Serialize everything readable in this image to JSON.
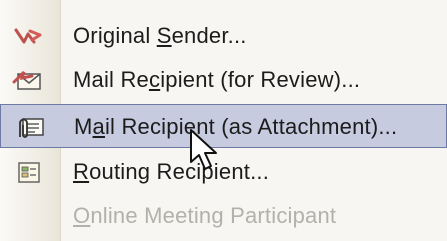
{
  "menu": {
    "items": [
      {
        "id": "original-sender",
        "label_pre": "Original ",
        "label_ul": "S",
        "label_post": "ender...",
        "icon": "forward-arrow-icon",
        "state": "normal"
      },
      {
        "id": "mail-recipient-review",
        "label_pre": "Mail Re",
        "label_ul": "c",
        "label_post": "ipient (for Review)...",
        "icon": "envelope-review-icon",
        "state": "normal"
      },
      {
        "id": "mail-recipient-attachment",
        "label_pre": "M",
        "label_ul": "a",
        "label_post": "il Recipient (as Attachment)...",
        "icon": "envelope-attachment-icon",
        "state": "hover"
      },
      {
        "id": "routing-recipient",
        "label_pre": "",
        "label_ul": "R",
        "label_post": "outing Recipient...",
        "icon": "routing-slip-icon",
        "state": "normal"
      },
      {
        "id": "online-meeting",
        "label_pre": "",
        "label_ul": "O",
        "label_post": "nline Meeting Participant",
        "icon": "",
        "state": "disabled"
      }
    ]
  },
  "colors": {
    "hover_bg": "#c7cbe0",
    "hover_border": "#6e7aa3",
    "disabled_text": "#b3b1ab",
    "text": "#1c1c1c"
  },
  "cursor": {
    "icon": "mouse-pointer-icon"
  }
}
